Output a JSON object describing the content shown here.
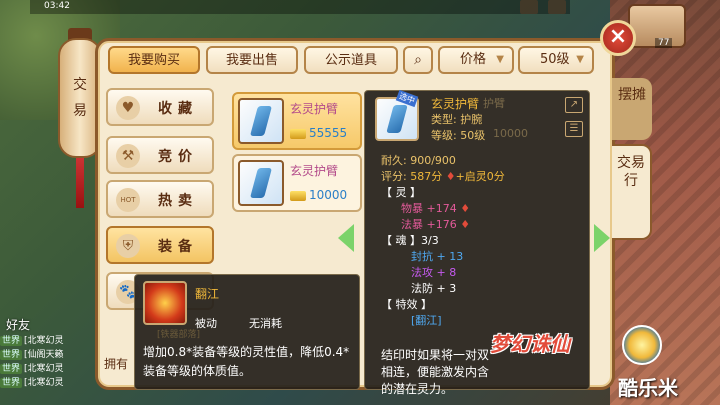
{
  "status": {
    "time": "03:42",
    "level_display": "77"
  },
  "lantern": {
    "line1": "交",
    "line2": "易"
  },
  "friend_label": "好友",
  "chat": [
    {
      "tag": "世界",
      "text": "[北寒幻灵"
    },
    {
      "tag": "世界",
      "text": "[仙阁天籁"
    },
    {
      "tag": "世界",
      "text": "[北寒幻灵"
    },
    {
      "tag": "世界",
      "text": "[北寒幻灵"
    }
  ],
  "toolbar": {
    "buy": "我要购买",
    "sell": "我要出售",
    "public": "公示道具",
    "price": "价格",
    "level": "50级"
  },
  "right_tabs": {
    "stall": "摆摊",
    "trade": "交易行"
  },
  "categories": [
    {
      "label": "收藏",
      "icon": "heart-icon",
      "glyph": "♥"
    },
    {
      "label": "竞价",
      "icon": "gavel-icon",
      "glyph": "⚒"
    },
    {
      "label": "热卖",
      "icon": "hot-icon",
      "glyph": "HOT"
    },
    {
      "label": "装备",
      "icon": "armor-icon",
      "glyph": "⛨"
    },
    {
      "label": "",
      "icon": "paw-icon",
      "glyph": "🐾"
    }
  ],
  "items": [
    {
      "name": "玄灵护臂",
      "price": "55555"
    },
    {
      "name": "玄灵护臂",
      "price": "10000"
    }
  ],
  "tooltip": {
    "badge": "选中",
    "name": "玄灵护臂",
    "type": "类型: 护腕",
    "level": "等级: 50级",
    "shadow_name": "护臂",
    "shadow_price": "10000",
    "durability": "耐久:  900/900",
    "score_label": "评分:",
    "score": "587分",
    "bonus": "+启灵0分",
    "ling_header": "【 灵 】",
    "ling1": "物暴 +174",
    "ling2": "法暴 +176",
    "hun_header": "【 魂 】3/3",
    "hun1": "封抗 + 13",
    "hun2": "法攻 + 8",
    "hun3": "法防 + 3",
    "te_header": "【 特效 】",
    "te1": "[翻江]",
    "seal_text": "结印时如果将一对双相连，便能激发内含的潜在灵力。"
  },
  "skill": {
    "name": "翻江",
    "passive": "被动",
    "cost": "无消耗",
    "description": "增加0.8*装备等级的灵性值，降低0.4*装备等级的体质值。",
    "ghost": "[铁器部落]"
  },
  "have_label": "拥有",
  "brand": "梦幻诛仙",
  "watermark": "酷乐米"
}
